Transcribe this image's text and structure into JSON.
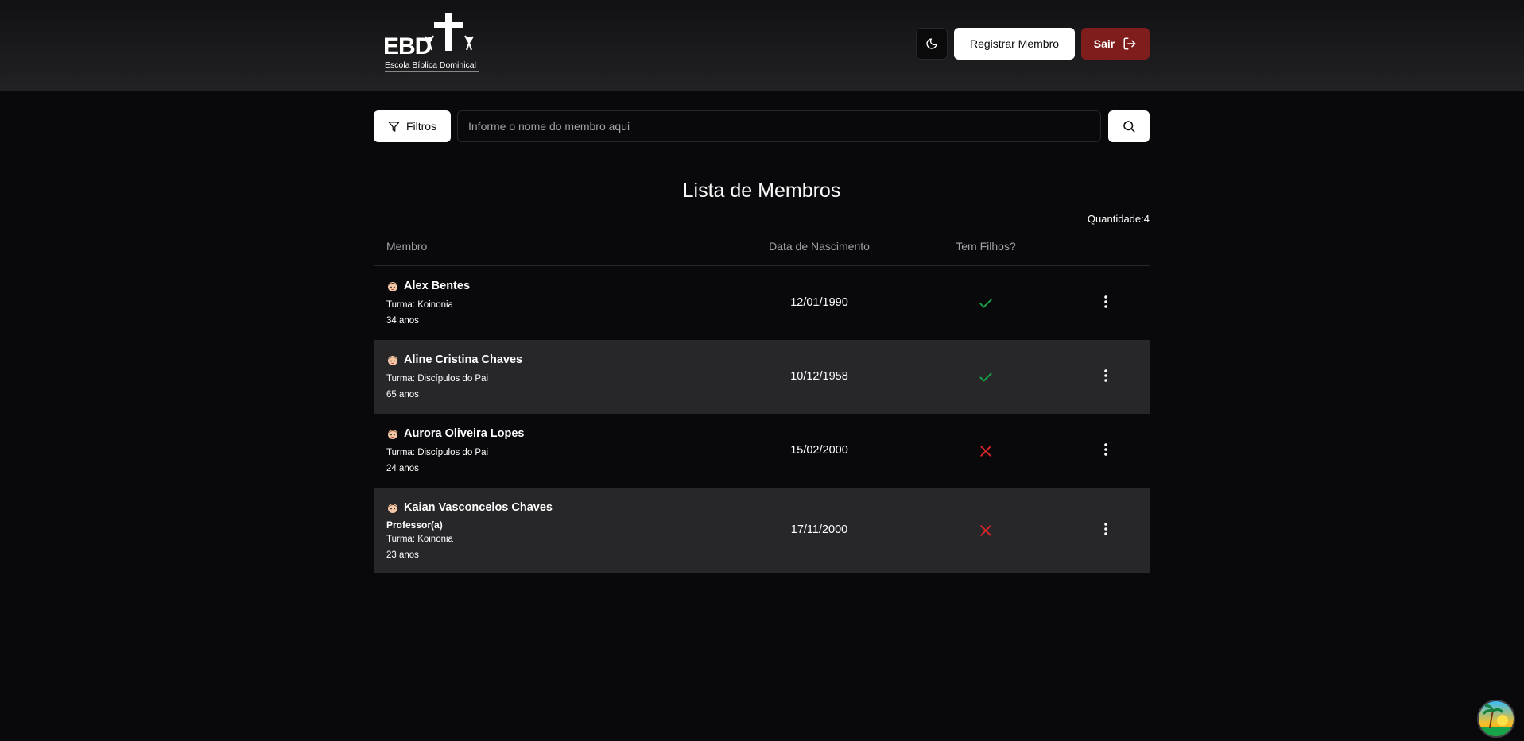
{
  "header": {
    "logo": {
      "brand": "EBD",
      "subtitle": "Escola Bíblica Dominical",
      "icon": "cross-logo-icon"
    },
    "theme_toggle_icon": "moon-icon",
    "register_label": "Registrar Membro",
    "logout_label": "Sair",
    "logout_icon": "logout-icon",
    "logout_color": "#7f1d1d"
  },
  "search": {
    "filters_label": "Filtros",
    "filters_icon": "filter-icon",
    "placeholder": "Informe o nome do membro aqui",
    "value": "",
    "search_icon": "search-icon"
  },
  "main": {
    "title": "Lista de Membros",
    "count_label": "Quantidade:",
    "count_value": "4"
  },
  "table": {
    "columns": [
      "Membro",
      "Data de Nascimento",
      "Tem Filhos?"
    ],
    "rows": [
      {
        "name": "Alex Bentes",
        "role": "",
        "turma": "Turma: Koinonia",
        "age": "34 anos",
        "birth": "12/01/1990",
        "has_children": true,
        "avatar": "boy-avatar-icon"
      },
      {
        "name": "Aline Cristina Chaves",
        "role": "",
        "turma": "Turma: Discípulos do Pai",
        "age": "65 anos",
        "birth": "10/12/1958",
        "has_children": true,
        "avatar": "girl-avatar-icon"
      },
      {
        "name": "Aurora Oliveira Lopes",
        "role": "",
        "turma": "Turma: Discípulos do Pai",
        "age": "24 anos",
        "birth": "15/02/2000",
        "has_children": false,
        "avatar": "girl-avatar-icon"
      },
      {
        "name": "Kaian Vasconcelos Chaves",
        "role": "Professor(a)",
        "turma": "Turma: Koinonia",
        "age": "23 anos",
        "birth": "17/11/2000",
        "has_children": false,
        "avatar": "boy-avatar-icon"
      }
    ],
    "yes_color": "#16a34a",
    "no_color": "#dc2626"
  }
}
